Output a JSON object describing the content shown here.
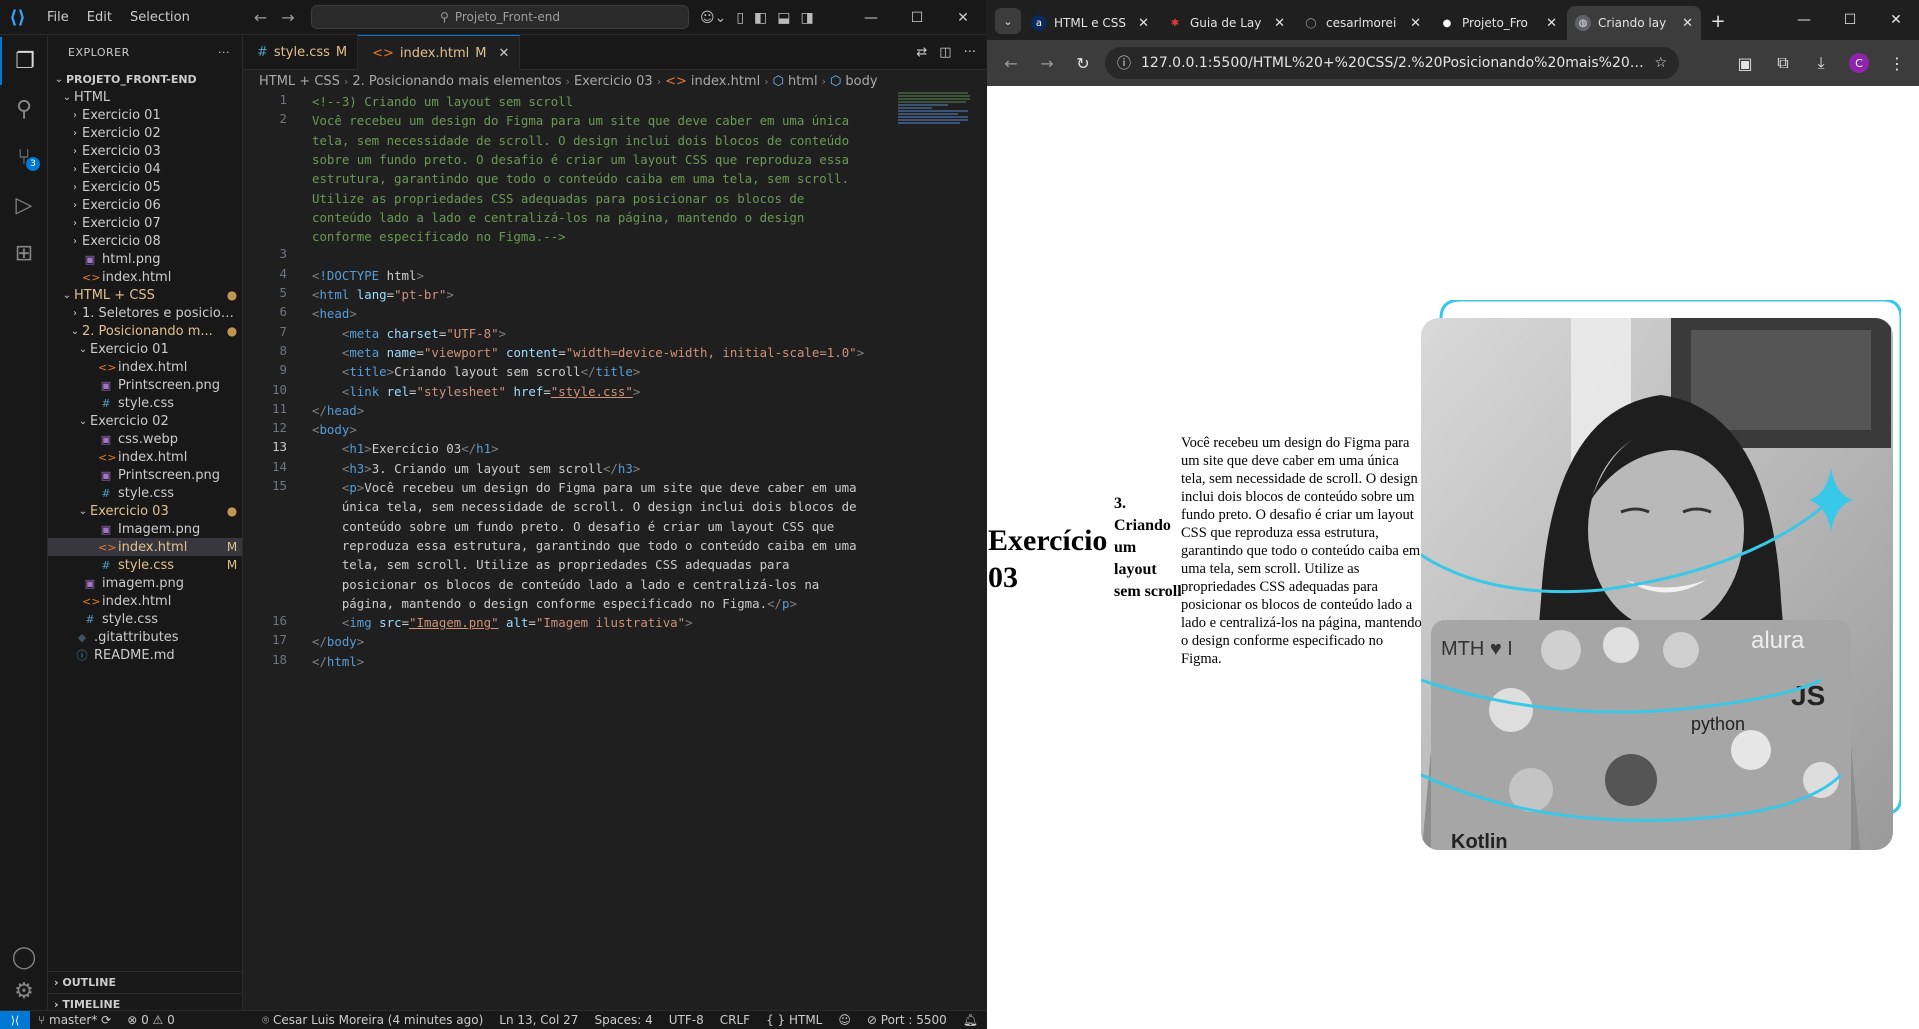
{
  "vscode": {
    "menu": [
      "File",
      "Edit",
      "Selection"
    ],
    "search_placeholder": "Projeto_Front-end",
    "explorer_title": "EXPLORER",
    "explorer_more": "···",
    "tree": [
      {
        "label": "PROJETO_FRONT-END",
        "chevron": "v",
        "depth": 0,
        "bold": true
      },
      {
        "label": "HTML",
        "chevron": "v",
        "depth": 1
      },
      {
        "label": "Exercicio 01",
        "chevron": ">",
        "depth": 2
      },
      {
        "label": "Exercicio 02",
        "chevron": ">",
        "depth": 2
      },
      {
        "label": "Exercicio 03",
        "chevron": ">",
        "depth": 2
      },
      {
        "label": "Exercicio 04",
        "chevron": ">",
        "depth": 2
      },
      {
        "label": "Exercicio 05",
        "chevron": ">",
        "depth": 2
      },
      {
        "label": "Exercicio 06",
        "chevron": ">",
        "depth": 2
      },
      {
        "label": "Exercicio 07",
        "chevron": ">",
        "depth": 2
      },
      {
        "label": "Exercicio 08",
        "chevron": ">",
        "depth": 2
      },
      {
        "label": "html.png",
        "icon": "img",
        "depth": 2
      },
      {
        "label": "index.html",
        "icon": "html",
        "depth": 2
      },
      {
        "label": "HTML + CSS",
        "chevron": "v",
        "depth": 1,
        "modified": true,
        "mark": "●"
      },
      {
        "label": "1. Seletores e posiciona...",
        "chevron": ">",
        "depth": 2
      },
      {
        "label": "2. Posicionando m...",
        "chevron": "v",
        "depth": 2,
        "modified": true,
        "mark": "●"
      },
      {
        "label": "Exercicio 01",
        "chevron": "v",
        "depth": 3
      },
      {
        "label": "index.html",
        "icon": "html",
        "depth": 4
      },
      {
        "label": "Printscreen.png",
        "icon": "img",
        "depth": 4
      },
      {
        "label": "style.css",
        "icon": "css",
        "depth": 4
      },
      {
        "label": "Exercicio 02",
        "chevron": "v",
        "depth": 3
      },
      {
        "label": "css.webp",
        "icon": "img",
        "depth": 4
      },
      {
        "label": "index.html",
        "icon": "html",
        "depth": 4
      },
      {
        "label": "Printscreen.png",
        "icon": "img",
        "depth": 4
      },
      {
        "label": "style.css",
        "icon": "css",
        "depth": 4
      },
      {
        "label": "Exercicio 03",
        "chevron": "v",
        "depth": 3,
        "modified": true,
        "mark": "●"
      },
      {
        "label": "Imagem.png",
        "icon": "img",
        "depth": 4
      },
      {
        "label": "index.html",
        "icon": "html",
        "depth": 4,
        "modified": true,
        "mark": "M",
        "selected": true
      },
      {
        "label": "style.css",
        "icon": "css",
        "depth": 4,
        "modified": true,
        "mark": "M"
      },
      {
        "label": "imagem.png",
        "icon": "img",
        "depth": 2
      },
      {
        "label": "index.html",
        "icon": "html",
        "depth": 2
      },
      {
        "label": "style.css",
        "icon": "css",
        "depth": 2
      },
      {
        "label": ".gitattributes",
        "icon": "git",
        "depth": 1
      },
      {
        "label": "README.md",
        "icon": "info",
        "depth": 1
      }
    ],
    "outline_label": "OUTLINE",
    "timeline_label": "TIMELINE",
    "tabs": [
      {
        "label": "style.css",
        "mark": "M",
        "icon": "#"
      },
      {
        "label": "index.html",
        "mark": "M",
        "icon": "<>",
        "active": true
      }
    ],
    "breadcrumb": [
      "HTML + CSS",
      "2. Posicionando mais elementos",
      "Exercicio 03",
      "index.html",
      "html",
      "body"
    ],
    "current_line": "13",
    "code": [
      {
        "n": "1",
        "t": "<!--3) Criando um layout sem scroll"
      },
      {
        "n": "2",
        "t": "Você recebeu um design do Figma para um site que deve caber em uma única"
      },
      {
        "n": "",
        "t": "tela, sem necessidade de scroll. O design inclui dois blocos de conteúdo"
      },
      {
        "n": "",
        "t": "sobre um fundo preto. O desafio é criar um layout CSS que reproduza essa"
      },
      {
        "n": "",
        "t": "estrutura, garantindo que todo o conteúdo caiba em uma tela, sem scroll."
      },
      {
        "n": "",
        "t": "Utilize as propriedades CSS adequadas para posicionar os blocos de"
      },
      {
        "n": "",
        "t": "conteúdo lado a lado e centralizá-los na página, mantendo o design"
      },
      {
        "n": "",
        "t": "conforme especificado no Figma.-->"
      },
      {
        "n": "3",
        "t": ""
      },
      {
        "n": "4",
        "t": "<!DOCTYPE html>"
      },
      {
        "n": "5",
        "t": "<html lang=\"pt-br\">"
      },
      {
        "n": "6",
        "t": "<head>"
      },
      {
        "n": "7",
        "t": "    <meta charset=\"UTF-8\">"
      },
      {
        "n": "8",
        "t": "    <meta name=\"viewport\" content=\"width=device-width, initial-scale=1.0\">"
      },
      {
        "n": "9",
        "t": "    <title>Criando layout sem scroll</title>"
      },
      {
        "n": "10",
        "t": "    <link rel=\"stylesheet\" href=\"style.css\">"
      },
      {
        "n": "11",
        "t": "</head>"
      },
      {
        "n": "12",
        "t": "<body>"
      },
      {
        "n": "13",
        "t": "    <h1>Exercício 03</h1>"
      },
      {
        "n": "14",
        "t": "    <h3>3. Criando um layout sem scroll</h3>"
      },
      {
        "n": "15",
        "t": "    <p>Você recebeu um design do Figma para um site que deve caber em uma"
      },
      {
        "n": "",
        "t": "    única tela, sem necessidade de scroll. O design inclui dois blocos de"
      },
      {
        "n": "",
        "t": "    conteúdo sobre um fundo preto. O desafio é criar um layout CSS que"
      },
      {
        "n": "",
        "t": "    reproduza essa estrutura, garantindo que todo o conteúdo caiba em uma"
      },
      {
        "n": "",
        "t": "    tela, sem scroll. Utilize as propriedades CSS adequadas para"
      },
      {
        "n": "",
        "t": "    posicionar os blocos de conteúdo lado a lado e centralizá-los na"
      },
      {
        "n": "",
        "t": "    página, mantendo o design conforme especificado no Figma.</p>"
      },
      {
        "n": "16",
        "t": "    <img src=\"Imagem.png\" alt=\"Imagem ilustrativa\">"
      },
      {
        "n": "17",
        "t": "</body>"
      },
      {
        "n": "18",
        "t": "</html>"
      }
    ],
    "status": {
      "branch": "master*",
      "problems": "⊗ 0 ⚠ 0",
      "blame": "Cesar Luis Moreira (4 minutes ago)",
      "position": "Ln 13, Col 27",
      "spaces": "Spaces: 4",
      "encoding": "UTF-8",
      "eol": "CRLF",
      "language": "HTML",
      "port": "Port : 5500"
    }
  },
  "chrome": {
    "tabs": [
      {
        "label": "HTML e CSS",
        "favicon": "a",
        "fav_bg": "#0a2a5c",
        "fav_fg": "#ffffff"
      },
      {
        "label": "Guia de Lay",
        "favicon": "✱",
        "fav_bg": "#1f1f1f",
        "fav_fg": "#e53935"
      },
      {
        "label": "cesarlmorei",
        "favicon": "◯",
        "fav_bg": "#1f1f1f",
        "fav_fg": "#9e9e9e"
      },
      {
        "label": "Projeto_Fro",
        "favicon": "●",
        "fav_bg": "#1f1f1f",
        "fav_fg": "#ffffff"
      },
      {
        "label": "Criando lay",
        "favicon": "◍",
        "fav_bg": "#5f6368",
        "fav_fg": "#e3e3e3",
        "active": true
      }
    ],
    "url": "127.0.0.1:5500/HTML%20+%20CSS/2.%20Posicionando%20mais%20elementos/Ex...",
    "avatar_letter": "C"
  },
  "page": {
    "h1": "Exercício 03",
    "h3": "3. Criando um layout sem scroll",
    "p": "Você recebeu um design do Figma para um site que deve caber em uma única tela, sem necessidade de scroll. O design inclui dois blocos de conteúdo sobre um fundo preto. O desafio é criar um layout CSS que reproduza essa estrutura, garantindo que todo o conteúdo caiba em uma tela, sem scroll. Utilize as propriedades CSS adequadas para posicionar os blocos de conteúdo lado a lado e centralizá-los na página, mantendo o design conforme especificado no Figma.",
    "img_alt": "Imagem ilustrativa",
    "laptop_stickers": [
      "MTH ♥ I",
      "alura",
      "JS",
      "python",
      "Kotlin"
    ],
    "accent_color": "#39c8e8"
  }
}
